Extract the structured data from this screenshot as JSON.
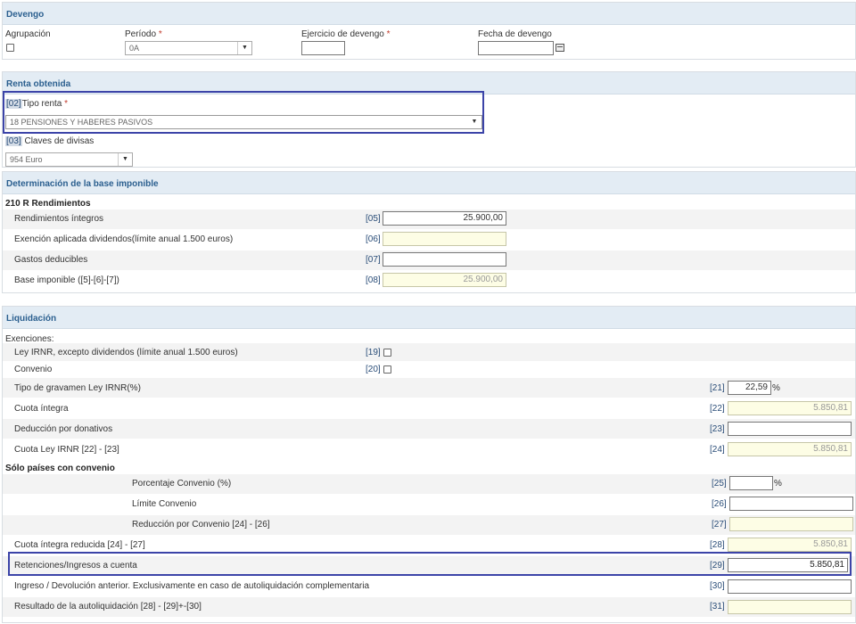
{
  "devengo": {
    "title": "Devengo",
    "agrupacion_label": "Agrupación",
    "periodo_label": "Período",
    "periodo_value": "0A",
    "ejercicio_label": "Ejercicio de devengo",
    "ejercicio_value": "",
    "fecha_label": "Fecha de devengo",
    "fecha_value": "",
    "required_mark": "*"
  },
  "renta": {
    "title": "Renta obtenida",
    "tipo_code": "[02]",
    "tipo_label": "Tipo renta",
    "tipo_value": "18 PENSIONES Y HABERES PASIVOS",
    "divisas_code": "[03]",
    "divisas_label": "Claves de divisas",
    "divisas_value": "954 Euro"
  },
  "base": {
    "title": "Determinación de la base imponible",
    "subtitle": "210 R Rendimientos",
    "rows": [
      {
        "label": "Rendimientos íntegros",
        "code": "[05]",
        "value": "25.900,00"
      },
      {
        "label": "Exención aplicada dividendos(límite anual 1.500 euros)",
        "code": "[06]",
        "value": ""
      },
      {
        "label": "Gastos deducibles",
        "code": "[07]",
        "value": ""
      },
      {
        "label": "Base imponible ([5]-[6]-[7])",
        "code": "[08]",
        "value": "25.900,00"
      }
    ]
  },
  "liquidacion": {
    "title": "Liquidación",
    "exenciones_label": "Exenciones:",
    "ley_label": "Ley IRNR, excepto dividendos (límite anual 1.500 euros)",
    "ley_code": "[19]",
    "convenio_label": "Convenio",
    "convenio_code": "[20]",
    "rows": [
      {
        "label": "Tipo de gravamen Ley IRNR(%)",
        "code": "[21]",
        "value": "22,59",
        "suffix": "%"
      },
      {
        "label": "Cuota íntegra",
        "code": "[22]",
        "value": "5.850,81"
      },
      {
        "label": "Deducción por donativos",
        "code": "[23]",
        "value": ""
      },
      {
        "label": "Cuota Ley IRNR [22] - [23]",
        "code": "[24]",
        "value": "5.850,81"
      }
    ],
    "paises_label": "Sólo países con convenio",
    "paises_rows": [
      {
        "label": "Porcentaje Convenio (%)",
        "code": "[25]",
        "value": "",
        "suffix": "%"
      },
      {
        "label": "Límite Convenio",
        "code": "[26]",
        "value": ""
      },
      {
        "label": "Reducción por Convenio [24] - [26]",
        "code": "[27]",
        "value": ""
      }
    ],
    "final_rows": [
      {
        "label": "Cuota íntegra reducida [24] - [27]",
        "code": "[28]",
        "value": "5.850,81"
      },
      {
        "label": "Retenciones/Ingresos a cuenta",
        "code": "[29]",
        "value": "5.850,81"
      },
      {
        "label": "Ingreso / Devolución anterior. Exclusivamente en caso de autoliquidación complementaria",
        "code": "[30]",
        "value": ""
      },
      {
        "label": "Resultado de la autoliquidación [28] - [29]+-[30]",
        "code": "[31]",
        "value": ""
      }
    ]
  },
  "colors": {
    "header_bg": "#e3ecf4",
    "header_text": "#2b5f8f",
    "highlight": "#3c44a8",
    "readonly_bg": "#fdfde5"
  }
}
